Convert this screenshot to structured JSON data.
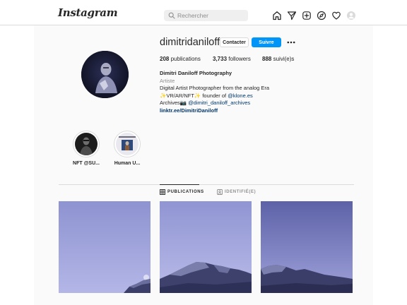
{
  "header": {
    "logo": "Instagram",
    "search": {
      "placeholder": "Rechercher"
    },
    "nav_icons": [
      "home-icon",
      "direct-icon",
      "new-post-icon",
      "explore-icon",
      "activity-icon",
      "profile-avatar-icon"
    ]
  },
  "profile": {
    "username": "dimitridaniloff",
    "contact_label": "Contacter",
    "follow_label": "Suivre",
    "stats": {
      "posts": "208",
      "posts_label": "publications",
      "followers": "3,733",
      "followers_label": "followers",
      "following": "888",
      "following_label": "suivi(e)s"
    },
    "bio": {
      "name": "Dimitri Daniloff Photography",
      "category": "Artiste",
      "line1": "Digital Artist Photographer from the analog Era",
      "line2_prefix": "✨VR/AR/NFT✨ founder of ",
      "line2_link": "@klone.es",
      "line3_prefix": "Archives📷 ",
      "line3_link": "@dimitri_daniloff_archives",
      "website": "linktr.ee/DimitriDaniloff"
    }
  },
  "highlights": [
    {
      "label": "NFT @SU..."
    },
    {
      "label": "Human U..."
    }
  ],
  "tabs": {
    "posts": "PUBLICATIONS",
    "tagged": "IDENTIFIÉ(E)"
  },
  "colors": {
    "accent": "#0095f6",
    "link": "#00376b",
    "sky": "#9a9ed8"
  }
}
